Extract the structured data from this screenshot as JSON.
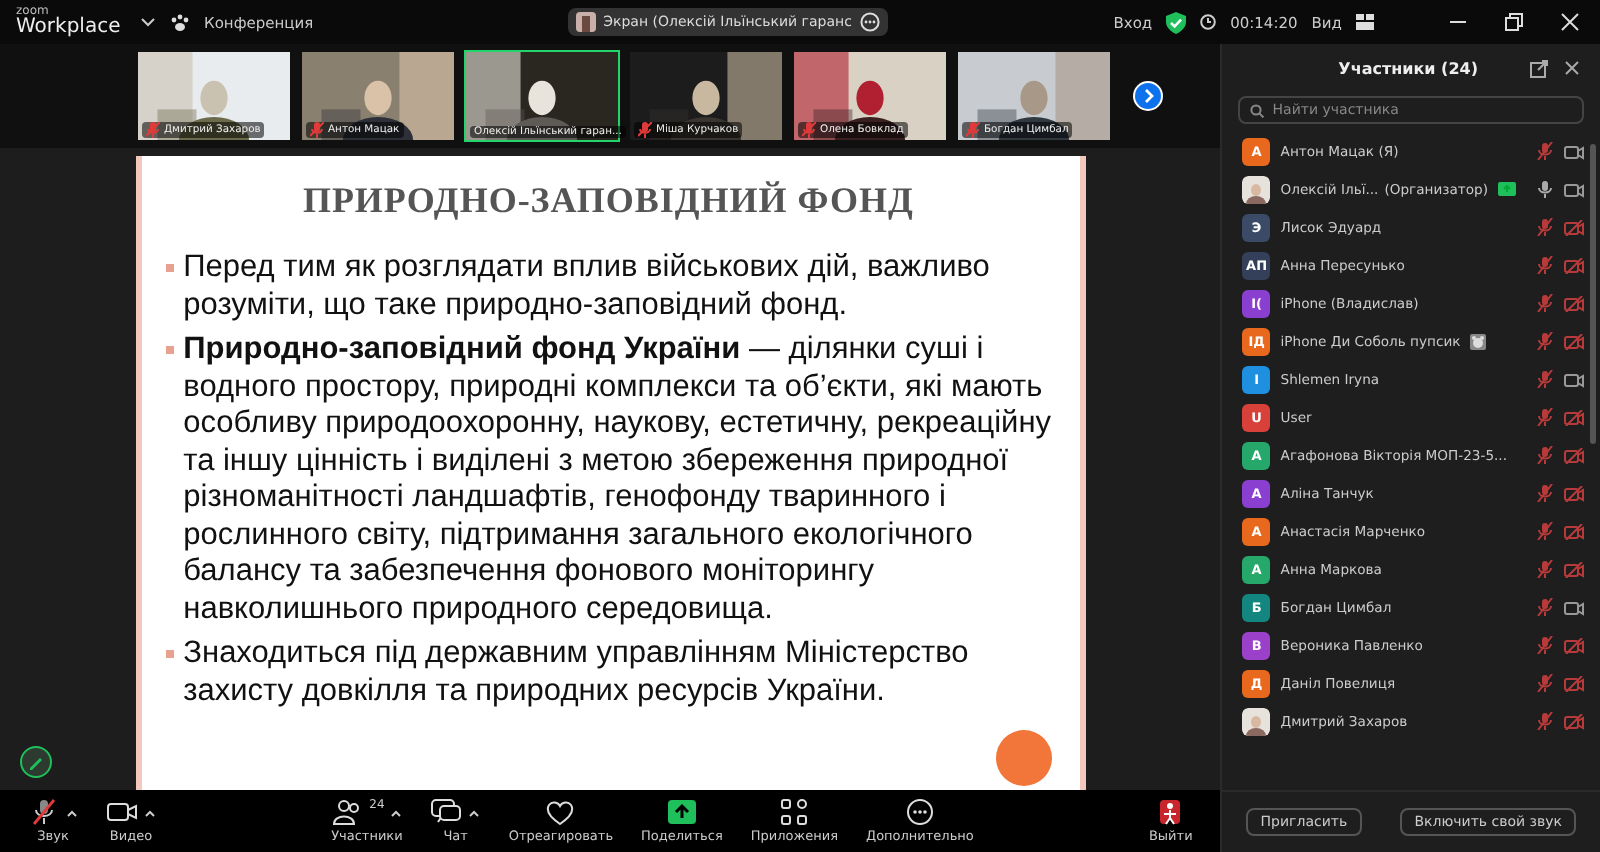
{
  "top_bar": {
    "logo_small": "zoom",
    "logo": "Workplace",
    "menu": "Конференция",
    "share_pill": "Экран (Олексій Ільїнський гаранс",
    "signin": "Вход",
    "timer": "00:14:20",
    "view": "Вид"
  },
  "video_strip": [
    {
      "name": "Дмитрий Захаров",
      "muted": true,
      "speaking": false
    },
    {
      "name": "Антон Мацак",
      "muted": true,
      "speaking": false
    },
    {
      "name": "Олексій Ільїнський гаран...",
      "muted": false,
      "speaking": true
    },
    {
      "name": "Міша Курчаков",
      "muted": true,
      "speaking": false
    },
    {
      "name": "Олена Бовклад",
      "muted": true,
      "speaking": false
    },
    {
      "name": "Богдан Цимбал",
      "muted": true,
      "speaking": false
    }
  ],
  "slide": {
    "title": "ПРИРОДНО-ЗАПОВІДНИЙ ФОНД",
    "bullets": [
      "Перед тим як розглядати вплив військових дій, важливо розуміти, що таке природно-заповідний фонд.",
      "**Природно-заповідний фонд України** — ділянки суші і водного простору, природні комплекси та об’єкти, які мають особливу природоохоронну, наукову, естетичну, рекреаційну та іншу цінність і виділені з метою збереження природної різноманітності ландшафтів, генофонду тваринного і рослинного світу, підтримання загального екологічного балансу та забезпечення фонового моніторингу навколишнього природного середовища.",
      "Знаходиться під державним управлінням Міністерство захисту довкілля та природних ресурсів  України."
    ]
  },
  "toolbar": [
    {
      "kind": "mic",
      "label": "Звук",
      "caret": true,
      "muted": true
    },
    {
      "kind": "video",
      "label": "Видео",
      "caret": true
    },
    {
      "kind": "participants",
      "label": "Участники",
      "caret": true,
      "count": "24"
    },
    {
      "kind": "chat",
      "label": "Чат",
      "caret": true
    },
    {
      "kind": "react",
      "label": "Отреагировать",
      "caret": false
    },
    {
      "kind": "share",
      "label": "Поделиться",
      "caret": false
    },
    {
      "kind": "apps",
      "label": "Приложения",
      "caret": false
    },
    {
      "kind": "more",
      "label": "Дополнительно",
      "caret": false
    },
    {
      "kind": "leave",
      "label": "Выйти",
      "caret": false
    }
  ],
  "participants": {
    "title": "Участники (24)",
    "search": {
      "placeholder": "Найти участника"
    },
    "items": [
      {
        "avatar": "А",
        "color": "#e8681e",
        "name": "Антон Мацак (Я)",
        "mic_muted": true,
        "video_off": false
      },
      {
        "name": "Олексій Ільї...",
        "role": "(Организатор)",
        "sharing": true,
        "mic_muted": false,
        "video_off": false
      },
      {
        "avatar": "Э",
        "color": "#3b4a66",
        "name": "Лисок Эдуард",
        "mic_muted": true,
        "video_off": true
      },
      {
        "avatar": "АП",
        "color": "#34405a",
        "name": "Анна Пересунько",
        "mic_muted": true,
        "video_off": true
      },
      {
        "avatar": "I(",
        "color": "#8a3fd1",
        "name": "iPhone (Владислав)",
        "mic_muted": true,
        "video_off": true
      },
      {
        "avatar": "IД",
        "color": "#e8681e",
        "name": "iPhone Ди Соболь пупсик",
        "emoji": true,
        "mic_muted": true,
        "video_off": true
      },
      {
        "avatar": "I",
        "color": "#1f8fe0",
        "name": "Shlemen Iryna",
        "mic_muted": true,
        "video_off": false
      },
      {
        "avatar": "U",
        "color": "#d8413a",
        "name": "User",
        "mic_muted": true,
        "video_off": true
      },
      {
        "avatar": "А",
        "color": "#25a86a",
        "name": "Агафонова Вікторія МОП-23-5...",
        "mic_muted": true,
        "video_off": true
      },
      {
        "avatar": "А",
        "color": "#8a3fd1",
        "name": "Аліна Танчук",
        "mic_muted": true,
        "video_off": true
      },
      {
        "avatar": "А",
        "color": "#e8681e",
        "name": "Анастасія Марченко",
        "mic_muted": true,
        "video_off": true
      },
      {
        "avatar": "А",
        "color": "#25a86a",
        "name": "Анна Маркова",
        "mic_muted": true,
        "video_off": true
      },
      {
        "avatar": "Б",
        "color": "#13877f",
        "name": "Богдан Цимбал",
        "mic_muted": true,
        "video_off": false
      },
      {
        "avatar": "В",
        "color": "#9b40c9",
        "name": "Вероника Павленко",
        "mic_muted": true,
        "video_off": true
      },
      {
        "avatar": "Д",
        "color": "#e8681e",
        "name": "Даніл Повелиця",
        "mic_muted": true,
        "video_off": true
      },
      {
        "name": "Дмитрий Захаров",
        "mic_muted": true,
        "video_off": true
      }
    ],
    "buttons": [
      "Пригласить",
      "Включить свой звук"
    ]
  }
}
